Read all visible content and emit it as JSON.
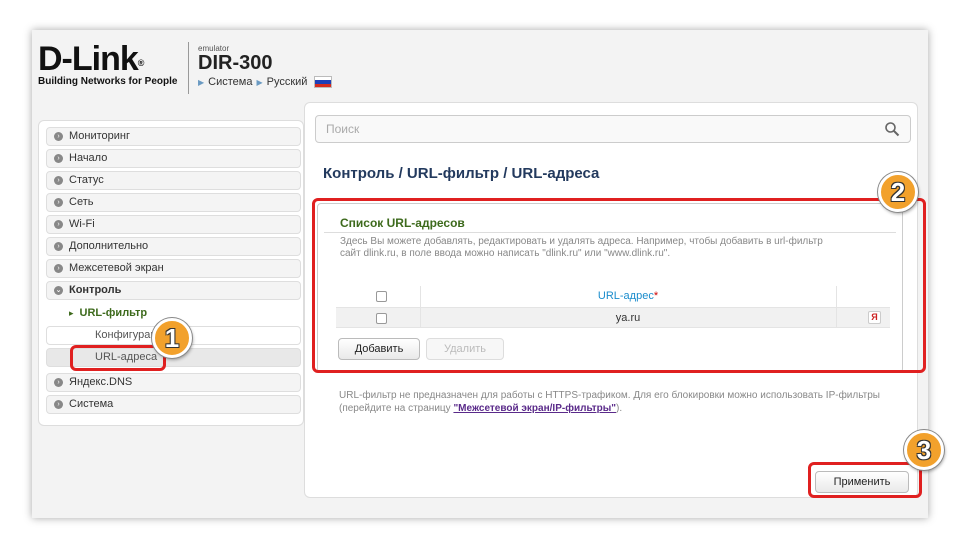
{
  "brand": {
    "logo": "D-Link",
    "logo_mark": "®",
    "tagline": "Building Networks for People",
    "emulator": "emulator",
    "model": "DIR-300",
    "link_system": "Система",
    "link_language": "Русский"
  },
  "sidebar": {
    "items": [
      {
        "label": "Мониторинг"
      },
      {
        "label": "Начало"
      },
      {
        "label": "Статус"
      },
      {
        "label": "Сеть"
      },
      {
        "label": "Wi-Fi"
      },
      {
        "label": "Дополнительно"
      },
      {
        "label": "Межсетевой экран"
      },
      {
        "label": "Контроль"
      },
      {
        "label": "URL-фильтр"
      },
      {
        "label": "Конфигурация"
      },
      {
        "label": "URL-адреса"
      },
      {
        "label": "Яндекс.DNS"
      },
      {
        "label": "Система"
      }
    ]
  },
  "search": {
    "placeholder": "Поиск"
  },
  "breadcrumb": "Контроль /  URL-фильтр /  URL-адреса",
  "panel": {
    "title": "Список URL-адресов",
    "description": "Здесь Вы можете добавлять, редактировать и удалять адреса. Например, чтобы добавить в url-фильтр сайт dlink.ru, в поле ввода можно написать \"dlink.ru\" или \"www.dlink.ru\".",
    "column_url": "URL-адрес",
    "required_mark": "*",
    "rows": [
      {
        "url": "ya.ru"
      }
    ],
    "add_label": "Добавить",
    "delete_label": "Удалить"
  },
  "note": {
    "text": "URL-фильтр не предназначен для работы с HTTPS-трафиком. Для его блокировки можно использовать IP-фильтры (перейдите на страницу ",
    "link": "\"Межсетевой экран/IP-фильтры\"",
    "tail": ")."
  },
  "apply_label": "Применить",
  "annotations": [
    "1",
    "2",
    "3"
  ],
  "colors": {
    "accent_green": "#3d6a1c",
    "title_blue": "#233a5e",
    "highlight_red": "#e02020",
    "badge_orange": "#f2a12c"
  }
}
